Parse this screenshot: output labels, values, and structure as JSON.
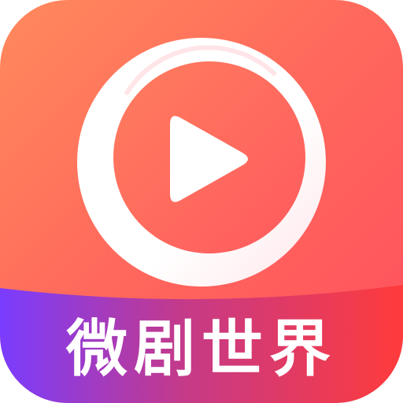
{
  "app": {
    "name": "微剧世界"
  },
  "icons": {
    "logo": "play-ring-icon"
  },
  "colors": {
    "background_start": "#ff8a5c",
    "background_end": "#ff4e5e",
    "banner_start": "#7a3cff",
    "banner_end": "#ff3b3b",
    "ring": "#ffffff",
    "play": "#ffffff"
  }
}
